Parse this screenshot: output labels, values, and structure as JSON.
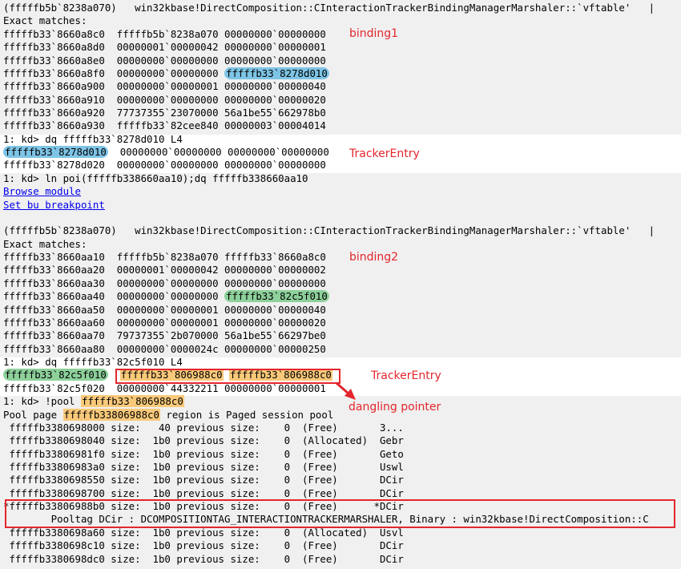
{
  "lines": [
    {
      "t": "(fffffb5b`8238a070)   win32kbase!DirectComposition::CInteractionTrackerBindingManagerMarshaler::`vftable'   |"
    },
    {
      "t": "Exact matches:"
    },
    {
      "t": "fffffb33`8660a8c0  fffffb5b`8238a070 00000000`00000000"
    },
    {
      "t": "fffffb33`8660a8d0  00000001`00000042 00000000`00000001"
    },
    {
      "t": "fffffb33`8660a8e0  00000000`00000000 00000000`00000000"
    },
    {
      "seg": [
        {
          "t": "fffffb33`8660a8f0  00000000`00000000 "
        },
        {
          "t": "fffffb33`8278d010",
          "c": "blue"
        }
      ]
    },
    {
      "t": "fffffb33`8660a900  00000000`00000001 00000000`00000040"
    },
    {
      "t": "fffffb33`8660a910  00000000`00000000 00000000`00000020"
    },
    {
      "t": "fffffb33`8660a920  77737355`23070000 56a1be55`662978b0"
    },
    {
      "t": "fffffb33`8660a930  fffffb33`82cee840 00000003`00004014"
    },
    {
      "t": "1: kd> dq fffffb33`8278d010 L4"
    },
    {
      "seg": [
        {
          "t": "fffffb33`8278d010",
          "c": "blue"
        },
        {
          "t": "  00000000`00000000 00000000`00000000"
        }
      ]
    },
    {
      "t": "fffffb33`8278d020  00000000`00000000 00000000`00000000"
    },
    {
      "t": "1: kd> ln poi(fffffb338660aa10);dq fffffb338660aa10"
    },
    {
      "seg": [
        {
          "t": "Browse module",
          "c": "link"
        }
      ]
    },
    {
      "seg": [
        {
          "t": "Set bu breakpoint",
          "c": "link"
        }
      ]
    },
    {
      "t": ""
    },
    {
      "t": "(fffffb5b`8238a070)   win32kbase!DirectComposition::CInteractionTrackerBindingManagerMarshaler::`vftable'   |"
    },
    {
      "t": "Exact matches:"
    },
    {
      "t": "fffffb33`8660aa10  fffffb5b`8238a070 fffffb33`8660a8c0"
    },
    {
      "t": "fffffb33`8660aa20  00000001`00000042 00000000`00000002"
    },
    {
      "t": "fffffb33`8660aa30  00000000`00000000 00000000`00000000"
    },
    {
      "seg": [
        {
          "t": "fffffb33`8660aa40  00000000`00000000 "
        },
        {
          "t": "fffffb33`82c5f010",
          "c": "green"
        }
      ]
    },
    {
      "t": "fffffb33`8660aa50  00000000`00000001 00000000`00000040"
    },
    {
      "t": "fffffb33`8660aa60  00000000`00000001 00000000`00000020"
    },
    {
      "t": "fffffb33`8660aa70  79737355`2b070000 56a1be55`66297be0"
    },
    {
      "t": "fffffb33`8660aa80  00000000`0000024c 00000000`00000250"
    },
    {
      "t": "1: kd> dq fffffb33`82c5f010 L4"
    },
    {
      "seg": [
        {
          "t": "fffffb33`82c5f010",
          "c": "green"
        },
        {
          "t": "  "
        },
        {
          "t": "fffffb33`806988c0",
          "c": "orange"
        },
        {
          "t": " "
        },
        {
          "t": "fffffb33`806988c0",
          "c": "orange"
        }
      ]
    },
    {
      "t": "fffffb33`82c5f020  00000000`44332211 00000000`00000001"
    },
    {
      "seg": [
        {
          "t": "1: kd> !pool "
        },
        {
          "t": "fffffb33`806988c0",
          "c": "orange"
        }
      ]
    },
    {
      "seg": [
        {
          "t": "Pool page "
        },
        {
          "t": "fffffb33806988c0",
          "c": "orange"
        },
        {
          "t": " region is Paged session pool"
        }
      ]
    },
    {
      "t": " fffffb3380698000 size:   40 previous size:    0  (Free)       3..."
    },
    {
      "t": " fffffb3380698040 size:  1b0 previous size:    0  (Allocated)  Gebr"
    },
    {
      "t": " fffffb33806981f0 size:  1b0 previous size:    0  (Free)       Geto"
    },
    {
      "t": " fffffb33806983a0 size:  1b0 previous size:    0  (Free)       Uswl"
    },
    {
      "t": " fffffb3380698550 size:  1b0 previous size:    0  (Free)       DCir"
    },
    {
      "t": " fffffb3380698700 size:  1b0 previous size:    0  (Free)       DCir"
    },
    {
      "t": "*fffffb33806988b0 size:  1b0 previous size:    0  (Free)      *DCir"
    },
    {
      "t": "        Pooltag DCir : DCOMPOSITIONTAG_INTERACTIONTRACKERMARSHALER, Binary : win32kbase!DirectComposition::C"
    },
    {
      "t": " fffffb3380698a60 size:  1b0 previous size:    0  (Allocated)  Usvl"
    },
    {
      "t": " fffffb3380698c10 size:  1b0 previous size:    0  (Free)       DCir"
    },
    {
      "t": " fffffb3380698dc0 size:  1b0 previous size:    0  (Free)       DCir"
    }
  ],
  "annotations": {
    "binding1": "binding1",
    "tracker_entry_1": "TrackerEntry",
    "binding2": "binding2",
    "tracker_entry_2": "TrackerEntry",
    "dangling_pointer": "dangling pointer"
  },
  "colors": {
    "annotation_red": "#e3262d",
    "highlight_blue": "#7ec4e6",
    "highlight_green": "#8ed19b",
    "highlight_orange": "#f9c97a",
    "block_gray": "#f0f0f0"
  }
}
